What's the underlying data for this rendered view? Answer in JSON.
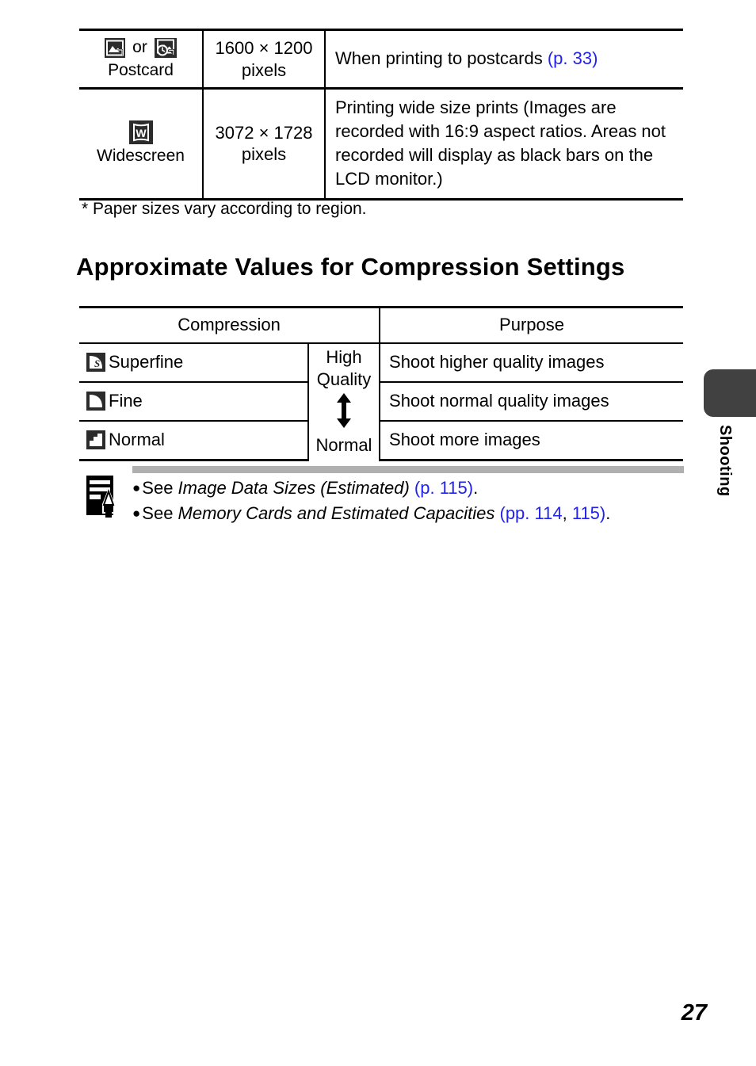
{
  "size_table": {
    "columns": [
      "mode",
      "pixels",
      "purpose"
    ],
    "rows": [
      {
        "icons": [
          "postcard-mode-icon",
          "date-stamp-icon"
        ],
        "conjunction": "or",
        "label": "Postcard",
        "pixels_line1": "1600 × 1200",
        "pixels_line2": "pixels",
        "purpose_text": "When printing to postcards ",
        "purpose_link": "(p. 33)",
        "purpose_tail": ""
      },
      {
        "icons": [
          "widescreen-mode-icon"
        ],
        "conjunction": "",
        "label": "Widescreen",
        "pixels_line1": "3072 × 1728",
        "pixels_line2": "pixels",
        "purpose_text": "Printing wide size prints (Images are recorded with 16:9 aspect ratios. Areas not recorded will display as black bars on the LCD monitor.)",
        "purpose_link": "",
        "purpose_tail": ""
      }
    ]
  },
  "footnote": "* Paper sizes vary according to region.",
  "heading": "Approximate Values for Compression Settings",
  "compression_table": {
    "headers": {
      "compression": "Compression",
      "purpose": "Purpose"
    },
    "quality_scale": {
      "top_line1": "High",
      "top_line2": "Quality",
      "bottom": "Normal"
    },
    "rows": [
      {
        "icon": "superfine-icon",
        "name": "Superfine",
        "purpose": "Shoot higher quality images"
      },
      {
        "icon": "fine-icon",
        "name": "Fine",
        "purpose": "Shoot normal quality images"
      },
      {
        "icon": "normal-icon",
        "name": "Normal",
        "purpose": "Shoot more images"
      }
    ]
  },
  "note": {
    "icon": "memo-pencil-icon",
    "lines": [
      {
        "bullet": "●",
        "prefix": "See ",
        "italic": "Image Data Sizes (Estimated)",
        "mid": " ",
        "link1": "(p. 115)",
        "between": "",
        "link2": "",
        "suffix": "."
      },
      {
        "bullet": "●",
        "prefix": "See ",
        "italic": "Memory Cards and Estimated Capacities",
        "mid": " ",
        "link1": "(pp. 114",
        "between": ", ",
        "link2": "115)",
        "suffix": "."
      }
    ]
  },
  "side_tab": {
    "label": "Shooting"
  },
  "page_number": "27",
  "colors": {
    "link": "#2222ee",
    "tab": "#414141",
    "note_bar": "#b0b0b0",
    "icon_bg": "#2b2b2b",
    "text": "#000000"
  }
}
